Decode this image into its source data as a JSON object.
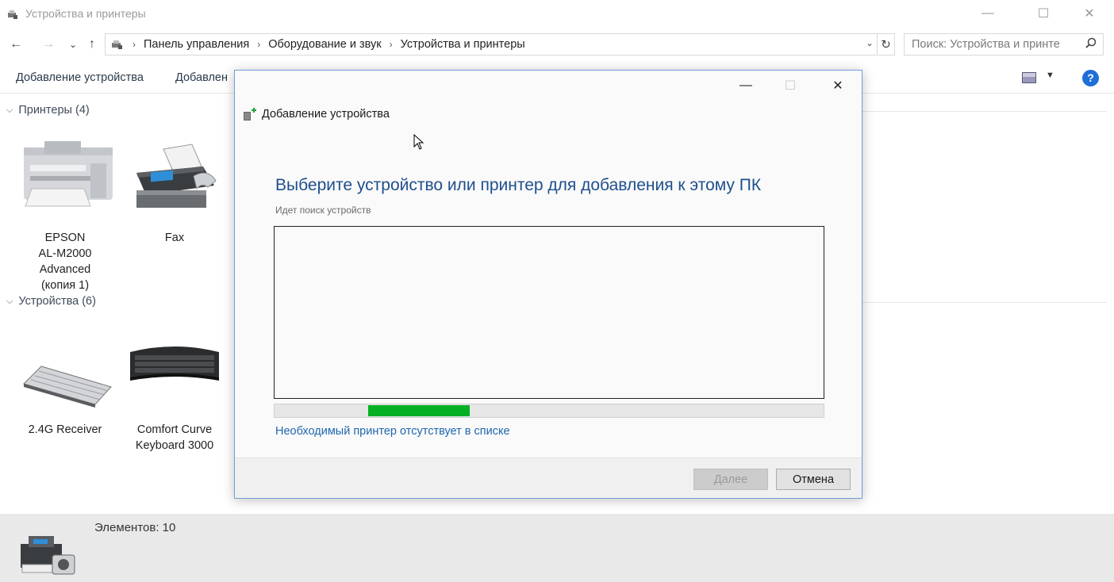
{
  "window": {
    "title": "Устройства и принтеры",
    "minimize": "—",
    "maximize": "☐",
    "close": "✕"
  },
  "nav": {
    "back": "←",
    "forward": "→",
    "recent": "⌄",
    "up": "↑",
    "refresh": "↻"
  },
  "breadcrumb": [
    "Панель управления",
    "Оборудование и звук",
    "Устройства и принтеры"
  ],
  "search": {
    "placeholder": "Поиск: Устройства и принте"
  },
  "toolbar": {
    "add_device": "Добавление устройства",
    "add_printer": "Добавлен"
  },
  "groups": {
    "printers": {
      "label": "Принтеры (4)"
    },
    "devices": {
      "label": "Устройства (6)"
    }
  },
  "printers": [
    {
      "name_lines": [
        "EPSON",
        "AL-M2000",
        "Advanced",
        "(копия 1)"
      ],
      "icon": "printer-icon"
    },
    {
      "name_lines": [
        "Fax"
      ],
      "icon": "fax-icon"
    }
  ],
  "devices": [
    {
      "name_lines": [
        "2.4G Receiver"
      ],
      "icon": "keyboard-flat-icon"
    },
    {
      "name_lines": [
        "Comfort Curve",
        "Keyboard 3000"
      ],
      "icon": "keyboard-black-icon"
    }
  ],
  "status": {
    "count": "Элементов: 10"
  },
  "dialog": {
    "title": "Добавление устройства",
    "heading": "Выберите устройство или принтер для добавления к этому ПК",
    "subtext": "Идет поиск устройств",
    "link": "Необходимый принтер отсутствует в списке",
    "next": "Далее",
    "cancel": "Отмена",
    "minimize": "—",
    "maximize": "☐",
    "close": "✕",
    "progress": {
      "start": 0.17,
      "end": 0.355
    }
  },
  "colors": {
    "heading": "#1e4f8c",
    "link": "#2067b0",
    "progress_fill": "#06b025",
    "dialog_border": "#6f9fd8"
  }
}
